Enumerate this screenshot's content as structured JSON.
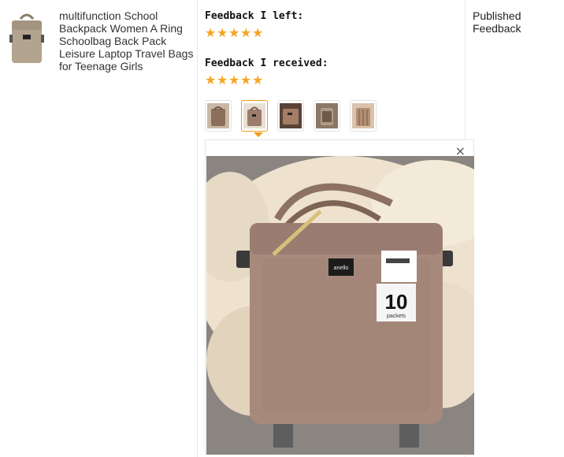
{
  "product": {
    "title": "multifunction School Backpack Women A Ring Schoolbag Back Pack Leisure Laptop Travel Bags for Teenage Girls",
    "thumbnail_icon": "bag-thumbnail"
  },
  "feedback": {
    "left_label": "Feedback I left:",
    "left_rating": 5,
    "received_label": "Feedback I received:",
    "received_rating": 5,
    "star_glyph": "★",
    "star_color": "#f5a623",
    "photos": [
      {
        "name": "photo-1",
        "active": false
      },
      {
        "name": "photo-2",
        "active": true
      },
      {
        "name": "photo-3",
        "active": false
      },
      {
        "name": "photo-4",
        "active": false
      },
      {
        "name": "photo-5",
        "active": false
      }
    ],
    "close_glyph": "×",
    "tag_number": "10",
    "tag_word": "packets",
    "brand_label": "anello"
  },
  "status": {
    "text": "Published Feedback"
  }
}
